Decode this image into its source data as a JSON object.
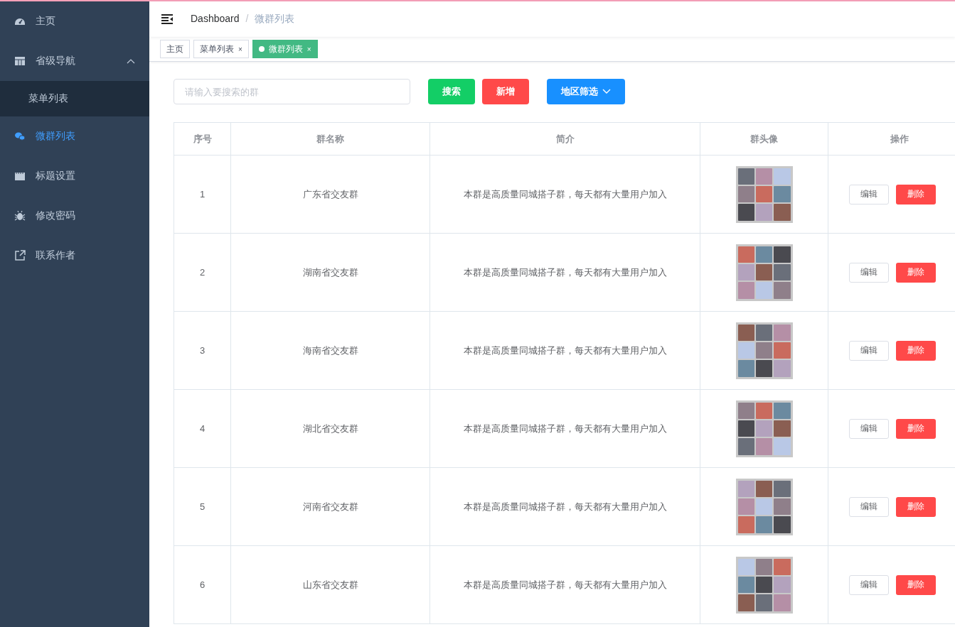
{
  "sidebar": {
    "items": [
      {
        "label": "主页",
        "selected": false
      },
      {
        "label": "省级导航",
        "selected": false,
        "expanded": true,
        "children": [
          {
            "label": "菜单列表",
            "selected": false
          }
        ]
      },
      {
        "label": "微群列表",
        "selected": true
      },
      {
        "label": "标题设置",
        "selected": false
      },
      {
        "label": "修改密码",
        "selected": false
      },
      {
        "label": "联系作者",
        "selected": false
      }
    ]
  },
  "breadcrumb": {
    "items": [
      "Dashboard",
      "微群列表"
    ],
    "separator": "/"
  },
  "tabs": [
    {
      "label": "主页",
      "selected": false
    },
    {
      "label": "菜单列表",
      "selected": false,
      "close": "×"
    },
    {
      "label": "微群列表",
      "selected": true,
      "close": "×"
    }
  ],
  "search": {
    "placeholder": "请输入要搜索的群"
  },
  "buttons": [
    {
      "label": "搜索",
      "kind": "success"
    },
    {
      "label": "新增",
      "kind": "danger"
    },
    {
      "label": "地区筛选",
      "kind": "dropdown"
    }
  ],
  "table": {
    "columns": [
      "序号",
      "群名称",
      "简介",
      "群头像",
      "操作"
    ],
    "rows": [
      {
        "index": "1",
        "name": "广东省交友群",
        "intro": "本群是高质量同城搭子群，每天都有大量用户加入",
        "actions": [
          "编辑",
          "删除"
        ]
      },
      {
        "index": "2",
        "name": "湖南省交友群",
        "intro": "本群是高质量同城搭子群，每天都有大量用户加入",
        "actions": [
          "编辑",
          "删除"
        ]
      },
      {
        "index": "3",
        "name": "海南省交友群",
        "intro": "本群是高质量同城搭子群，每天都有大量用户加入",
        "actions": [
          "编辑",
          "删除"
        ]
      },
      {
        "index": "4",
        "name": "湖北省交友群",
        "intro": "本群是高质量同城搭子群，每天都有大量用户加入",
        "actions": [
          "编辑",
          "删除"
        ]
      },
      {
        "index": "5",
        "name": "河南省交友群",
        "intro": "本群是高质量同城搭子群，每天都有大量用户加入",
        "actions": [
          "编辑",
          "删除"
        ]
      },
      {
        "index": "6",
        "name": "山东省交友群",
        "intro": "本群是高质量同城搭子群，每天都有大量用户加入",
        "actions": [
          "编辑",
          "删除"
        ]
      }
    ]
  }
}
